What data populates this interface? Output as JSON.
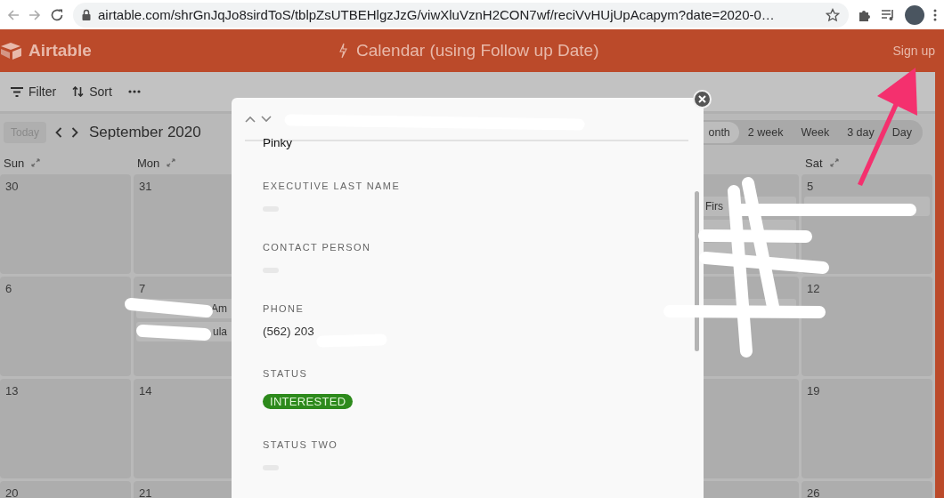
{
  "browser": {
    "url": "airtable.com/shrGnJqJo8sirdToS/tblpZsUTBEHlgzJzG/viwXluVznH2CON7wf/reciVvHUjUpAcapym?date=2020-0…"
  },
  "app_header": {
    "logo": "Airtable",
    "title": "Calendar (using Follow up Date)",
    "sign_up": "Sign up"
  },
  "toolbar": [
    {
      "kind": "filter",
      "label": "Filter"
    },
    {
      "kind": "sort",
      "label": "Sort"
    },
    {
      "kind": "more"
    }
  ],
  "calendar": {
    "today": "Today",
    "month": "September 2020",
    "views": [
      {
        "label": "onth",
        "selected": true
      },
      {
        "label": "2 week",
        "selected": false
      },
      {
        "label": "Week",
        "selected": false
      },
      {
        "label": "3 day",
        "selected": false
      },
      {
        "label": "Day",
        "selected": false
      }
    ],
    "headers": [
      {
        "kind": "name",
        "name": "Sun"
      },
      {
        "kind": "name",
        "name": "Mon"
      },
      {
        "kind": "blank"
      },
      {
        "kind": "blank"
      },
      {
        "kind": "blank"
      },
      {
        "kind": "blank"
      },
      {
        "kind": "name",
        "name": "Sat"
      }
    ],
    "weeks": [
      {
        "cells": [
          {
            "kind": "day",
            "date": "30"
          },
          {
            "kind": "day",
            "date": "31"
          },
          {
            "kind": "hidden"
          },
          {
            "kind": "hidden"
          },
          {
            "kind": "hidden"
          },
          {
            "kind": "day",
            "events": [
              {
                "kind": "text",
                "text": "Firs"
              },
              {
                "kind": "blank"
              },
              {
                "kind": "blank"
              }
            ]
          },
          {
            "kind": "day",
            "date": "5",
            "events": [
              {
                "kind": "blank"
              }
            ]
          }
        ]
      },
      {
        "cells": [
          {
            "kind": "day",
            "date": "6"
          },
          {
            "kind": "day",
            "date": "7",
            "events": [
              {
                "kind": "text",
                "text": "Am"
              },
              {
                "kind": "text",
                "text": "ula"
              }
            ]
          },
          {
            "kind": "hidden"
          },
          {
            "kind": "hidden"
          },
          {
            "kind": "hidden"
          },
          {
            "kind": "day",
            "events": [
              {
                "kind": "blank"
              }
            ]
          },
          {
            "kind": "day",
            "date": "12"
          }
        ]
      },
      {
        "cells": [
          {
            "kind": "day",
            "date": "13"
          },
          {
            "kind": "day",
            "date": "14"
          },
          {
            "kind": "hidden"
          },
          {
            "kind": "hidden"
          },
          {
            "kind": "hidden"
          },
          {
            "kind": "day"
          },
          {
            "kind": "day",
            "date": "19"
          }
        ]
      },
      {
        "cells": [
          {
            "kind": "day",
            "date": "20"
          },
          {
            "kind": "day",
            "date": "21"
          },
          {
            "kind": "hidden"
          },
          {
            "kind": "hidden"
          },
          {
            "kind": "hidden"
          },
          {
            "kind": "day"
          },
          {
            "kind": "day",
            "date": "26"
          }
        ]
      }
    ]
  },
  "record": {
    "top_value": "Pinky",
    "fields": [
      {
        "label": "EXECUTIVE LAST NAME",
        "kind": "empty"
      },
      {
        "label": "CONTACT PERSON",
        "kind": "empty"
      },
      {
        "label": "PHONE",
        "kind": "text",
        "value": "(562) 203"
      },
      {
        "label": "STATUS",
        "kind": "tag",
        "value": "INTERESTED"
      },
      {
        "label": "STATUS TWO",
        "kind": "empty"
      }
    ]
  }
}
